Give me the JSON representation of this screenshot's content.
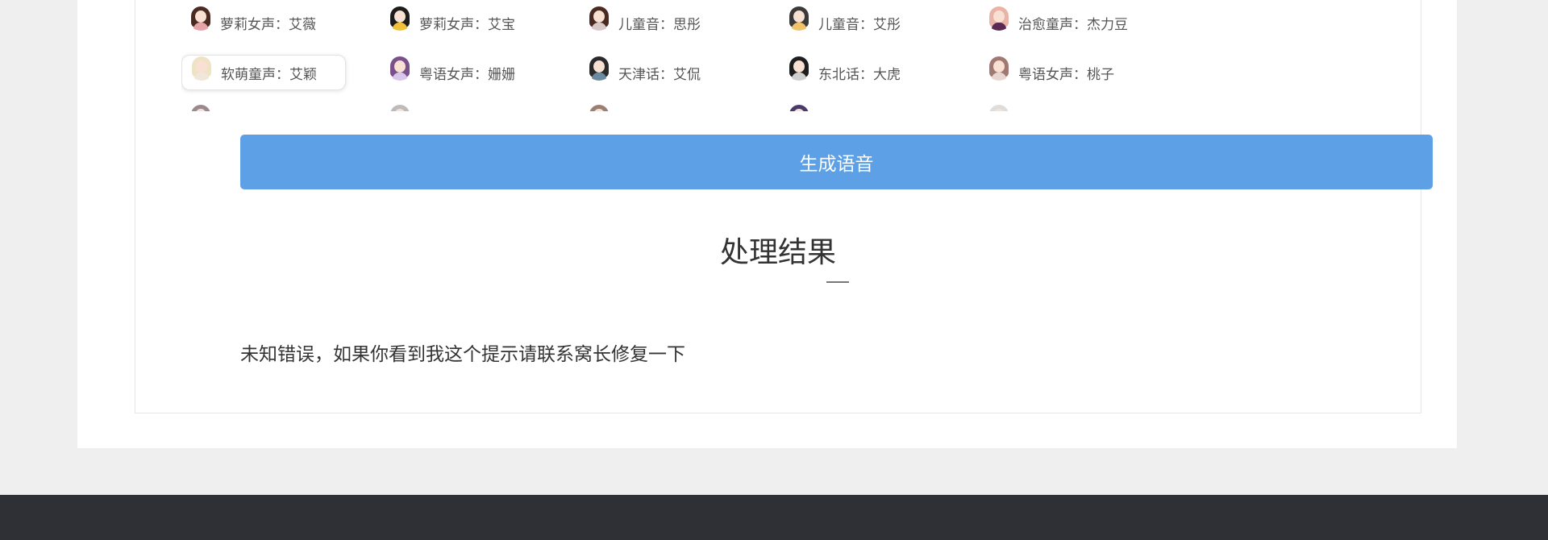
{
  "voices": [
    {
      "label": "萝莉女声：艾薇",
      "icon": "girl-avatar-icon",
      "hair": "#4a2b22",
      "body": "#e6a3a8"
    },
    {
      "label": "萝莉女声：艾宝",
      "icon": "girl-avatar-icon",
      "hair": "#1c1c1c",
      "body": "#f2c13a"
    },
    {
      "label": "儿童音：思彤",
      "icon": "girl-avatar-icon",
      "hair": "#4a2b22",
      "body": "#d9c8c8"
    },
    {
      "label": "儿童音：艾彤",
      "icon": "boy-avatar-icon",
      "hair": "#3a3a3a",
      "body": "#f0c36a"
    },
    {
      "label": "治愈童声：杰力豆",
      "icon": "child-avatar-icon",
      "hair": "#e8b4a8",
      "body": "#5a2a55"
    },
    {
      "label": "软萌童声：艾颖",
      "icon": "girl-avatar-icon",
      "hair": "#efe3c6",
      "body": "#f0e6da",
      "selected": true
    },
    {
      "label": "粤语女声：姗姗",
      "icon": "woman-avatar-icon",
      "hair": "#7a4f8a",
      "body": "#d7c7ea"
    },
    {
      "label": "天津话：艾侃",
      "icon": "man-avatar-icon",
      "hair": "#2a2a2a",
      "body": "#6a8aa0"
    },
    {
      "label": "东北话：大虎",
      "icon": "man-avatar-icon",
      "hair": "#1e1e1e",
      "body": "#cfcfcf"
    },
    {
      "label": "粤语女声：桃子",
      "icon": "woman-avatar-icon",
      "hair": "#a07a72",
      "body": "#e8d6d2"
    },
    {
      "label": "",
      "icon": "avatar-icon",
      "hair": "#9a8a8e",
      "body": "#cccccc"
    },
    {
      "label": "",
      "icon": "avatar-icon",
      "hair": "#bbbbbb",
      "body": "#dddddd"
    },
    {
      "label": "",
      "icon": "avatar-icon",
      "hair": "#9c7f74",
      "body": "#dddddd"
    },
    {
      "label": "",
      "icon": "avatar-icon",
      "hair": "#4a3a6a",
      "body": "#dddddd"
    },
    {
      "label": "",
      "icon": "avatar-icon",
      "hair": "#dddddd",
      "body": "#eeeeee"
    }
  ],
  "generate_button": "生成语音",
  "result": {
    "title": "处理结果",
    "message": "未知错误，如果你看到我这个提示请联系窝长修复一下"
  }
}
